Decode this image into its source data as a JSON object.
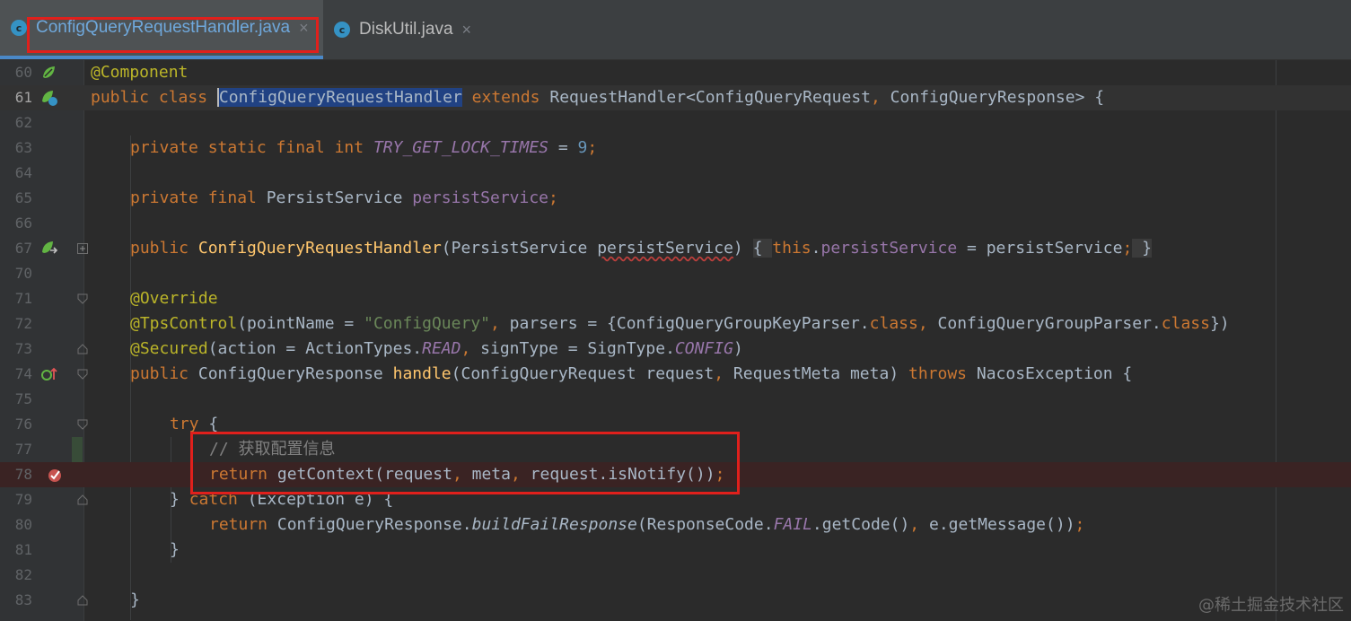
{
  "tabs": [
    {
      "label": "ConfigQueryRequestHandler.java",
      "icon": "class-icon",
      "active": true
    },
    {
      "label": "DiskUtil.java",
      "icon": "class-icon",
      "active": false
    }
  ],
  "tab_close_glyph": "×",
  "tab_icon_letter": "c",
  "lines": [
    {
      "n": "60"
    },
    {
      "n": "61"
    },
    {
      "n": "62"
    },
    {
      "n": "63"
    },
    {
      "n": "64"
    },
    {
      "n": "65"
    },
    {
      "n": "66"
    },
    {
      "n": "67"
    },
    {
      "n": "70"
    },
    {
      "n": "71"
    },
    {
      "n": "72"
    },
    {
      "n": "73"
    },
    {
      "n": "74"
    },
    {
      "n": "75"
    },
    {
      "n": "76"
    },
    {
      "n": "77"
    },
    {
      "n": "78"
    },
    {
      "n": "79"
    },
    {
      "n": "80"
    },
    {
      "n": "81"
    },
    {
      "n": "82"
    },
    {
      "n": "83"
    }
  ],
  "code": {
    "l60": {
      "ann": "@Component"
    },
    "l61": {
      "kw1": "public class ",
      "cls": "ConfigQueryRequestHandler",
      "kw2": " extends ",
      "rest": "RequestHandler<ConfigQueryRequest",
      "comma": ",",
      "rest2": " ConfigQueryResponse> {"
    },
    "l63": {
      "kw": "private static final int ",
      "const": "TRY_GET_LOCK_TIMES",
      "eq": " = ",
      "num": "9",
      "semi": ";"
    },
    "l65": {
      "kw": "private final ",
      "type": "PersistService ",
      "fld": "persistService",
      "semi": ";"
    },
    "l67": {
      "kw": "public ",
      "fn": "ConfigQueryRequestHandler",
      "p1": "(PersistService ",
      "param": "persistService",
      "p2": ") ",
      "ob": "{ ",
      "kw2": "this",
      "dot": ".",
      "fld": "persistService",
      "rest": " = persistService",
      "semi": ";",
      "cb": " }"
    },
    "l71": {
      "ann": "@Override"
    },
    "l72": {
      "ann": "@TpsControl",
      "p1": "(pointName = ",
      "str": "\"ConfigQuery\"",
      "comma": ",",
      "p2": " parsers = {ConfigQueryGroupKeyParser.",
      "kw": "class",
      "comma2": ",",
      "p3": " ConfigQueryGroupParser.",
      "kw2": "class",
      "p4": "})"
    },
    "l73": {
      "ann": "@Secured",
      "p1": "(action = ActionTypes.",
      "c1": "READ",
      "comma": ",",
      "p2": " signType = SignType.",
      "c2": "CONFIG",
      "p3": ")"
    },
    "l74": {
      "kw": "public ",
      "type": "ConfigQueryResponse ",
      "fn": "handle",
      "p1": "(ConfigQueryRequest request",
      "comma": ",",
      "p2": " RequestMeta meta) ",
      "kw2": "throws ",
      "p3": "NacosException {"
    },
    "l76": {
      "kw": "try ",
      "p1": "{"
    },
    "l77": {
      "cmt": "// 获取配置信息"
    },
    "l78": {
      "kw": "return ",
      "p1": "getContext(request",
      "c1": ",",
      "p2": " meta",
      "c2": ",",
      "p3": " request.isNotify())",
      "semi": ";"
    },
    "l79": {
      "p1": "} ",
      "kw": "catch ",
      "p2": "(Exception e) {"
    },
    "l80": {
      "kw": "return ",
      "p1": "ConfigQueryResponse.",
      "fn": "buildFailResponse",
      "p2": "(ResponseCode.",
      "c1": "FAIL",
      "p3": ".getCode()",
      "comma": ",",
      "p4": " e.getMessage())",
      "semi": ";"
    },
    "l81": {
      "p1": "}"
    },
    "l83": {
      "p1": "}"
    }
  },
  "watermark": "@稀土掘金技术社区",
  "colors": {
    "keyword": "#cc7832",
    "annotation": "#bbb529",
    "field": "#9876aa",
    "string": "#6a8759",
    "number": "#6897bb",
    "function": "#ffc66d",
    "highlight_box": "#e0201c"
  }
}
